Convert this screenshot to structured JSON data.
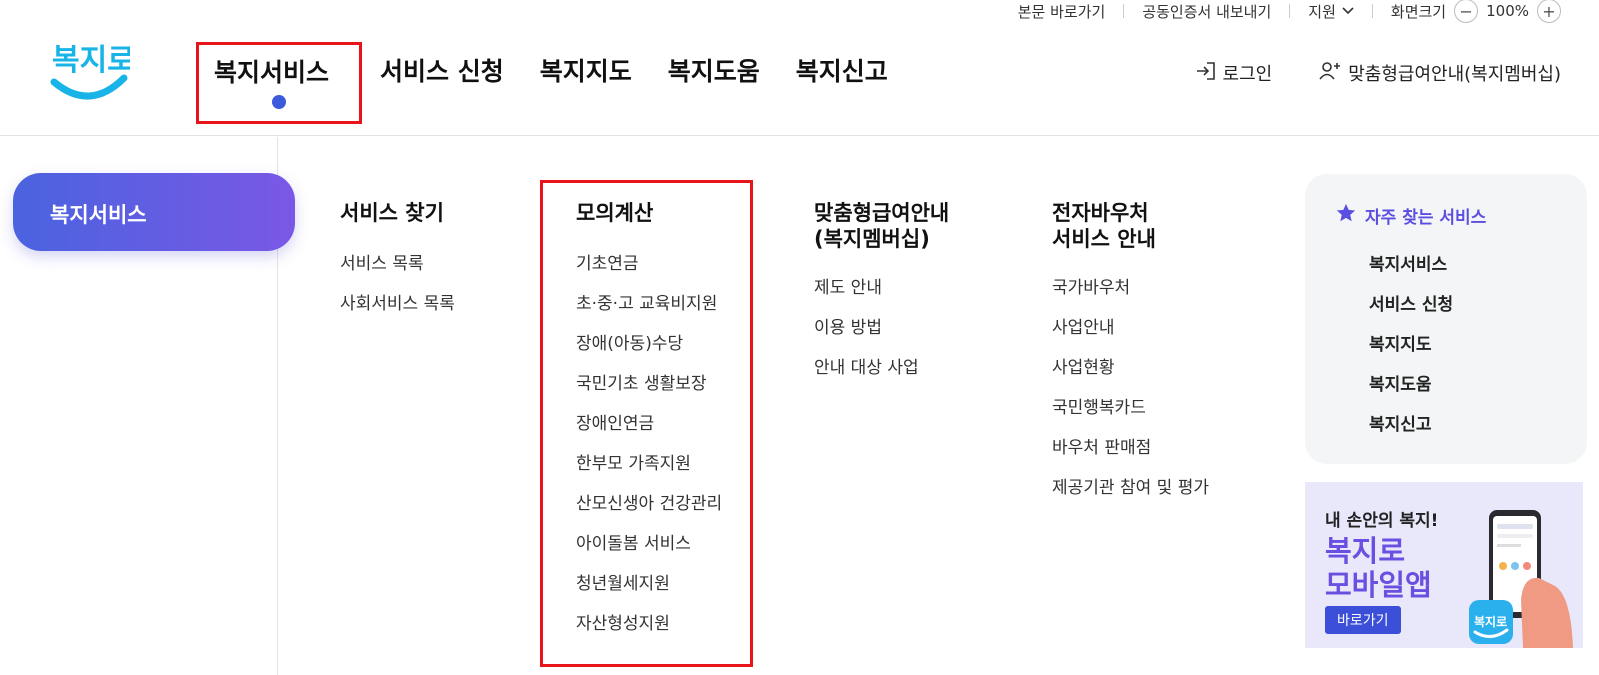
{
  "utility": {
    "skip": "본문 바로가기",
    "cert": "공동인증서 내보내기",
    "support": "지원",
    "zoom_label": "화면크기",
    "zoom_value": "100%"
  },
  "logo": {
    "text": "복지로"
  },
  "gnb": [
    "복지서비스",
    "서비스 신청",
    "복지지도",
    "복지도움",
    "복지신고"
  ],
  "header_right": {
    "login": "로그인",
    "membership": "맞춤형급여안내(복지멤버십)"
  },
  "left_pill": "복지서비스",
  "columns": [
    {
      "title": "서비스 찾기",
      "items": [
        "서비스 목록",
        "사회서비스 목록"
      ]
    },
    {
      "title": "모의계산",
      "items": [
        "기초연금",
        "초·중·고 교육비지원",
        "장애(아동)수당",
        "국민기초 생활보장",
        "장애인연금",
        "한부모 가족지원",
        "산모신생아 건강관리",
        "아이돌봄 서비스",
        "청년월세지원",
        "자산형성지원"
      ]
    },
    {
      "title": "맞춤형급여안내\n(복지멤버십)",
      "title1": "맞춤형급여안내",
      "title2": "(복지멤버십)",
      "items": [
        "제도 안내",
        "이용 방법",
        "안내 대상 사업"
      ]
    },
    {
      "title": "전자바우처\n서비스 안내",
      "title1": "전자바우처",
      "title2": "서비스 안내",
      "items": [
        "국가바우처",
        "사업안내",
        "사업현황",
        "국민행복카드",
        "바우처 판매점",
        "제공기관 참여 및 평가"
      ]
    }
  ],
  "quick": {
    "title": "자주 찾는 서비스",
    "items": [
      "복지서비스",
      "서비스 신청",
      "복지지도",
      "복지도움",
      "복지신고"
    ]
  },
  "banner": {
    "line1": "내 손안의 복지!",
    "line2": "복지로",
    "line3": "모바일앱",
    "button": "바로가기",
    "app_label": "복지로"
  },
  "colors": {
    "accent": "#3c5bdc",
    "highlight": "#e8141b",
    "purple": "#6a4fe0"
  }
}
